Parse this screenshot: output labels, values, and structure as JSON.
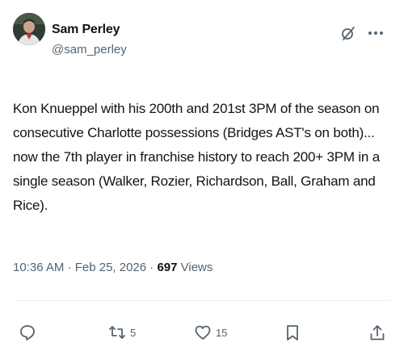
{
  "author": {
    "name": "Sam Perley",
    "handle": "@sam_perley"
  },
  "tweet": {
    "text": "Kon Knueppel with his 200th and 201st 3PM of the season on consecutive Charlotte possessions (Bridges AST's on both)... now the 7th player in franchise history to reach 200+ 3PM in a single season (Walker, Rozier, Richardson, Ball, Graham and Rice)."
  },
  "meta": {
    "timestamp": "10:36 AM · Feb 25, 2026 · ",
    "views_count": "697",
    "views_label": " Views"
  },
  "actions": {
    "reply_count": "",
    "repost_count": "5",
    "like_count": "15"
  },
  "icons": {
    "header": [
      "grok-icon",
      "more-icon"
    ],
    "actions": [
      "reply-icon",
      "repost-icon",
      "like-icon",
      "bookmark-icon",
      "share-icon"
    ]
  },
  "colors": {
    "text": "#0f1419",
    "secondary": "#536471",
    "background": "#ffffff"
  }
}
